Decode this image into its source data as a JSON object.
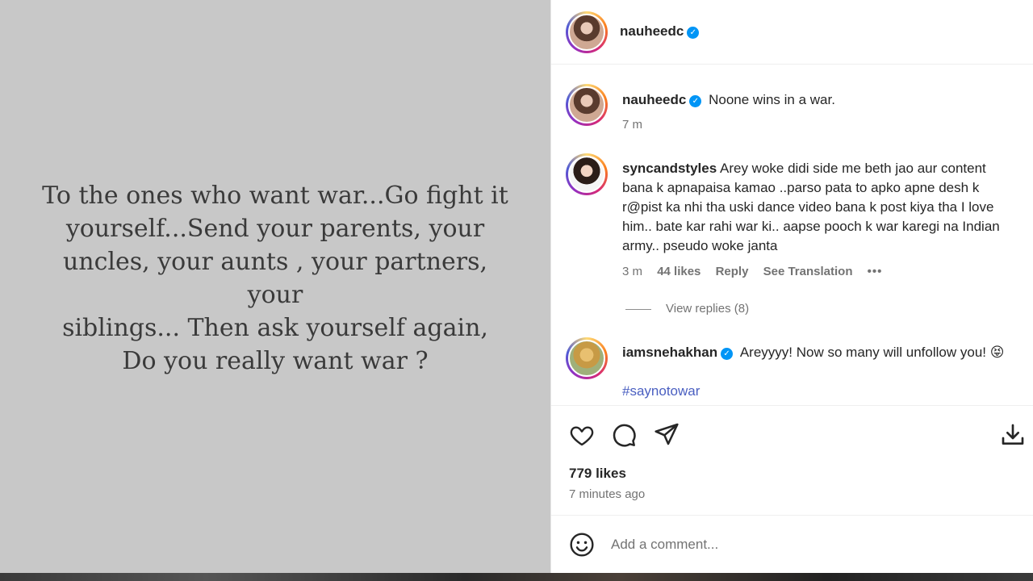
{
  "post_image": {
    "quote_lines": [
      "To the ones who want war...Go fight it",
      "yourself...Send your parents, your",
      "uncles, your aunts , your partners, your",
      "siblings... Then ask yourself again,",
      "Do you really want war ?"
    ]
  },
  "header": {
    "username": "nauheedc",
    "verified_icon": "verified-badge-icon"
  },
  "caption": {
    "username": "nauheedc",
    "text": "Noone wins in a war.",
    "time": "7 m"
  },
  "comments": [
    {
      "username": "syncandstyles",
      "lines": [
        "Arey woke didi side me beth jao aur content",
        "bana k apnapaisa kamao ..parso pata to apko apne desh k",
        "r@pist ka nhi tha uski dance video bana k post kiya tha I love",
        "him.. bate kar rahi war ki.. aapse pooch k war karegi na Indian",
        "army.. pseudo woke janta"
      ],
      "time": "3 m",
      "likes": "44 likes",
      "reply": "Reply",
      "see_translation": "See Translation",
      "more": "•••",
      "view_replies": "View replies (8)"
    },
    {
      "username": "iamsnehakhan",
      "text": "Areyyyy! Now so many will unfollow you!",
      "emoji": "😝",
      "hashtag": "#saynotowar"
    }
  ],
  "actions": {
    "like_icon": "heart-icon",
    "comment_icon": "comment-bubble-icon",
    "share_icon": "paper-plane-icon",
    "save_icon": "download-icon"
  },
  "stats": {
    "likes": "779 likes",
    "time_ago": "7 minutes ago"
  },
  "comment_box": {
    "emoji_icon": "smiley-icon",
    "placeholder": "Add a comment..."
  }
}
